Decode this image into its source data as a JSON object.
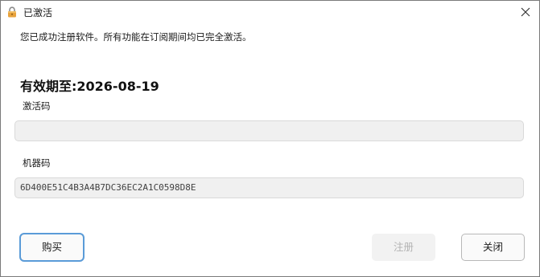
{
  "window": {
    "title": "已激活"
  },
  "message": "您已成功注册软件。所有功能在订阅期间均已完全激活。",
  "expiry_text": "有效期至:2026-08-19",
  "activation_code": {
    "label": "激活码",
    "value": ""
  },
  "machine_code": {
    "label": "机器码",
    "value": "6D400E51C4B3A4B7DC36EC2A1C0598D8E"
  },
  "buttons": {
    "buy": "购买",
    "register": "注册",
    "close": "关闭"
  },
  "icons": {
    "title_icon": "lock-icon",
    "close_icon": "close-icon"
  },
  "colors": {
    "focus_ring": "#5a9bd8",
    "disabled_text": "#b3b3b3",
    "field_background": "#f0f0f0",
    "lock_body": "#e8a33d"
  }
}
